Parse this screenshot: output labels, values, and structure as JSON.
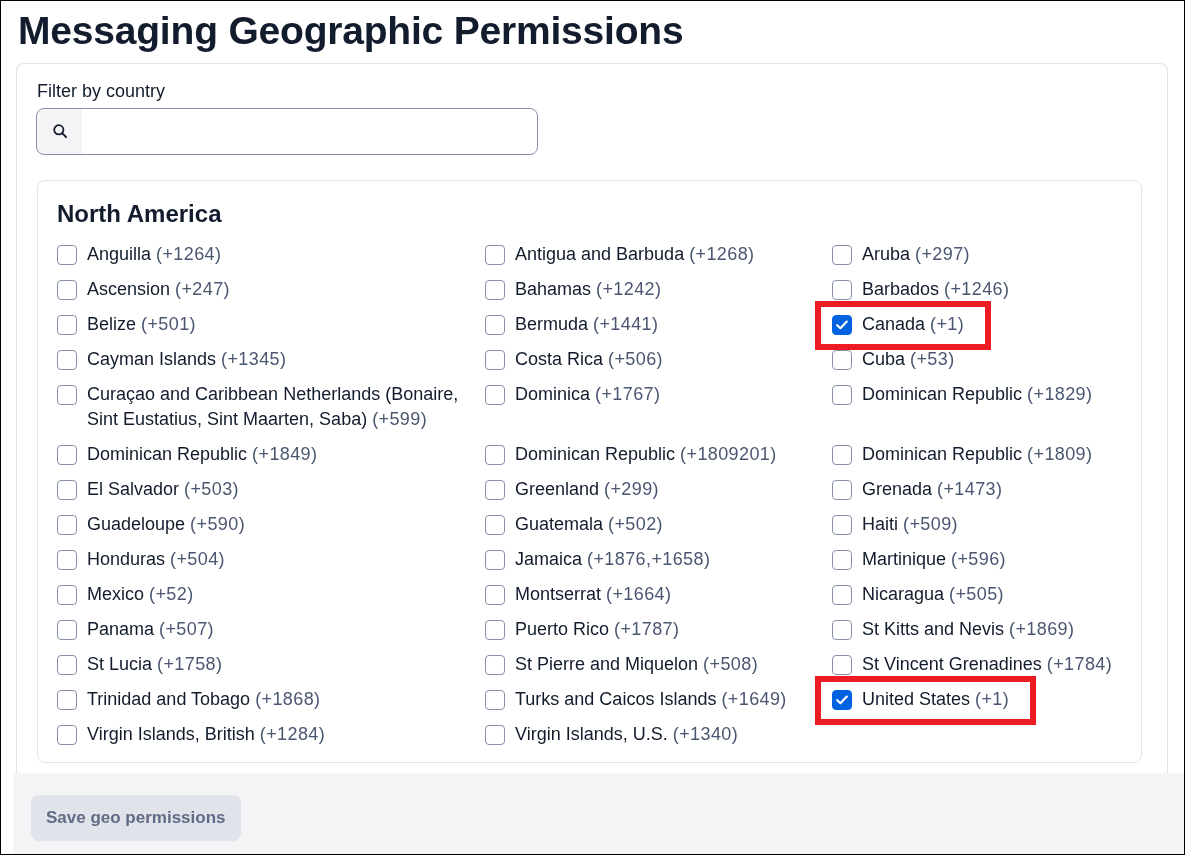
{
  "page": {
    "title": "Messaging Geographic Permissions"
  },
  "filter": {
    "label": "Filter by country"
  },
  "regions": [
    {
      "name": "North America",
      "countries": [
        {
          "name": "Anguilla",
          "code": "(+1264)",
          "checked": false,
          "highlighted": false
        },
        {
          "name": "Antigua and Barbuda",
          "code": "(+1268)",
          "checked": false,
          "highlighted": false
        },
        {
          "name": "Aruba",
          "code": "(+297)",
          "checked": false,
          "highlighted": false
        },
        {
          "name": "Ascension",
          "code": "(+247)",
          "checked": false,
          "highlighted": false
        },
        {
          "name": "Bahamas",
          "code": "(+1242)",
          "checked": false,
          "highlighted": false
        },
        {
          "name": "Barbados",
          "code": "(+1246)",
          "checked": false,
          "highlighted": false
        },
        {
          "name": "Belize",
          "code": "(+501)",
          "checked": false,
          "highlighted": false
        },
        {
          "name": "Bermuda",
          "code": "(+1441)",
          "checked": false,
          "highlighted": false
        },
        {
          "name": "Canada",
          "code": "(+1)",
          "checked": true,
          "highlighted": true
        },
        {
          "name": "Cayman Islands",
          "code": "(+1345)",
          "checked": false,
          "highlighted": false
        },
        {
          "name": "Costa Rica",
          "code": "(+506)",
          "checked": false,
          "highlighted": false
        },
        {
          "name": "Cuba",
          "code": "(+53)",
          "checked": false,
          "highlighted": false
        },
        {
          "name": "Curaçao and Caribbean Netherlands (Bonaire, Sint Eustatius, Sint Maarten, Saba)",
          "code": "(+599)",
          "checked": false,
          "highlighted": false
        },
        {
          "name": "Dominica",
          "code": "(+1767)",
          "checked": false,
          "highlighted": false
        },
        {
          "name": "Dominican Republic",
          "code": "(+1829)",
          "checked": false,
          "highlighted": false
        },
        {
          "name": "Dominican Republic",
          "code": "(+1849)",
          "checked": false,
          "highlighted": false
        },
        {
          "name": "Dominican Republic",
          "code": "(+1809201)",
          "checked": false,
          "highlighted": false
        },
        {
          "name": "Dominican Republic",
          "code": "(+1809)",
          "checked": false,
          "highlighted": false
        },
        {
          "name": "El Salvador",
          "code": "(+503)",
          "checked": false,
          "highlighted": false
        },
        {
          "name": "Greenland",
          "code": "(+299)",
          "checked": false,
          "highlighted": false
        },
        {
          "name": "Grenada",
          "code": "(+1473)",
          "checked": false,
          "highlighted": false
        },
        {
          "name": "Guadeloupe",
          "code": "(+590)",
          "checked": false,
          "highlighted": false
        },
        {
          "name": "Guatemala",
          "code": "(+502)",
          "checked": false,
          "highlighted": false
        },
        {
          "name": "Haiti",
          "code": "(+509)",
          "checked": false,
          "highlighted": false
        },
        {
          "name": "Honduras",
          "code": "(+504)",
          "checked": false,
          "highlighted": false
        },
        {
          "name": "Jamaica",
          "code": "(+1876,+1658)",
          "checked": false,
          "highlighted": false
        },
        {
          "name": "Martinique",
          "code": "(+596)",
          "checked": false,
          "highlighted": false
        },
        {
          "name": "Mexico",
          "code": "(+52)",
          "checked": false,
          "highlighted": false
        },
        {
          "name": "Montserrat",
          "code": "(+1664)",
          "checked": false,
          "highlighted": false
        },
        {
          "name": "Nicaragua",
          "code": "(+505)",
          "checked": false,
          "highlighted": false
        },
        {
          "name": "Panama",
          "code": "(+507)",
          "checked": false,
          "highlighted": false
        },
        {
          "name": "Puerto Rico",
          "code": "(+1787)",
          "checked": false,
          "highlighted": false
        },
        {
          "name": "St Kitts and Nevis",
          "code": "(+1869)",
          "checked": false,
          "highlighted": false
        },
        {
          "name": "St Lucia",
          "code": "(+1758)",
          "checked": false,
          "highlighted": false
        },
        {
          "name": "St Pierre and Miquelon",
          "code": "(+508)",
          "checked": false,
          "highlighted": false
        },
        {
          "name": "St Vincent Grenadines",
          "code": "(+1784)",
          "checked": false,
          "highlighted": false
        },
        {
          "name": "Trinidad and Tobago",
          "code": "(+1868)",
          "checked": false,
          "highlighted": false
        },
        {
          "name": "Turks and Caicos Islands",
          "code": "(+1649)",
          "checked": false,
          "highlighted": false
        },
        {
          "name": "United States",
          "code": "(+1)",
          "checked": true,
          "highlighted": true
        },
        {
          "name": "Virgin Islands, British",
          "code": "(+1284)",
          "checked": false,
          "highlighted": false
        },
        {
          "name": "Virgin Islands, U.S.",
          "code": "(+1340)",
          "checked": false,
          "highlighted": false
        }
      ]
    }
  ],
  "footer": {
    "save_button": {
      "label": "Save geo permissions",
      "disabled": true
    }
  }
}
